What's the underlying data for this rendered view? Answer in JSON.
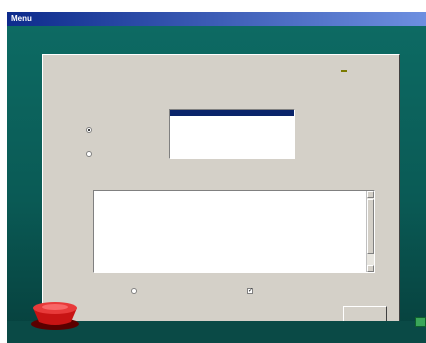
{
  "window": {
    "title": "Menu"
  },
  "panel": {
    "heading": "",
    "list_heading": "",
    "radio_selected_label": "",
    "radio_other_label": "",
    "list_items": [
      "",
      "",
      "",
      ""
    ],
    "log_heading": "",
    "log_lines": [
      "",
      "",
      "",
      "",
      "",
      "",
      "",
      "",
      "",
      "",
      "",
      ""
    ],
    "option_left_label": "",
    "option_right_label": "",
    "close_button_label": ""
  },
  "tooltip": {
    "text": ""
  },
  "colors": {
    "desktop": "#0d6a63",
    "panel": "#d4d0c8",
    "selection": "#0a246a",
    "tooltip": "#ffff66"
  }
}
